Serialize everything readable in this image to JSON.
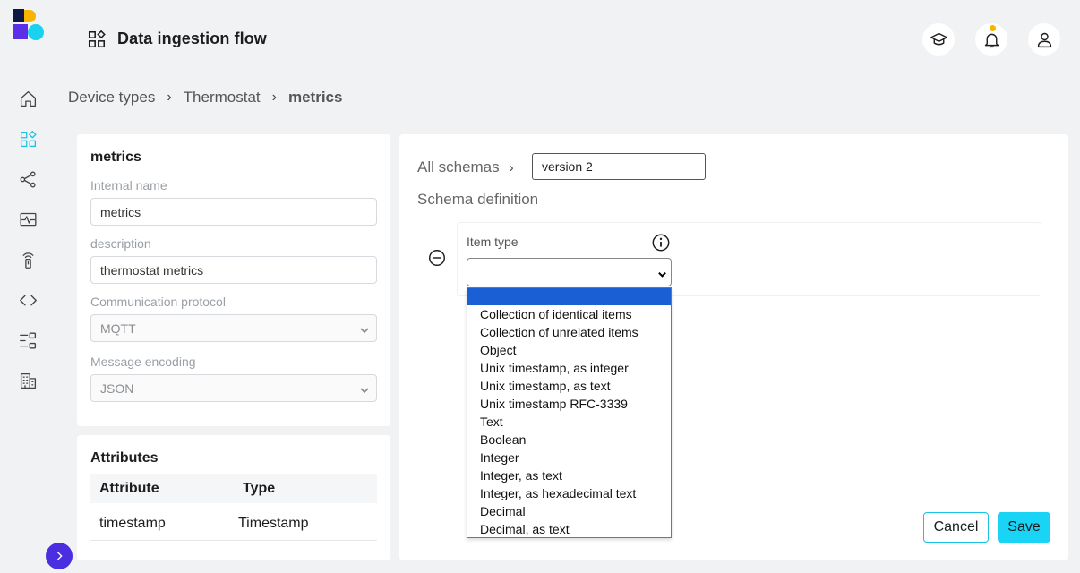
{
  "header": {
    "title": "Data ingestion flow"
  },
  "breadcrumb": [
    {
      "label": "Device types"
    },
    {
      "label": "Thermostat"
    },
    {
      "label": "metrics"
    }
  ],
  "breadcrumb_separator": "›",
  "details": {
    "title": "metrics",
    "internal_name_label": "Internal name",
    "internal_name_value": "metrics",
    "description_label": "description",
    "description_value": "thermostat metrics",
    "protocol_label": "Communication protocol",
    "protocol_value": "MQTT",
    "encoding_label": "Message encoding",
    "encoding_value": "JSON"
  },
  "attributes": {
    "title": "Attributes",
    "columns": [
      "Attribute",
      "Type"
    ],
    "rows": [
      {
        "attribute": "timestamp",
        "type": "Timestamp"
      }
    ]
  },
  "schema": {
    "crumb": "All schemas",
    "separator": "›",
    "version_value": "version 2",
    "definition_label": "Schema definition",
    "item_type_label": "Item type",
    "item_type_value": "",
    "options": [
      "",
      "Collection of identical items",
      "Collection of unrelated items",
      "Object",
      "Unix timestamp, as integer",
      "Unix timestamp, as text",
      "Unix timestamp RFC-3339",
      "Text",
      "Boolean",
      "Integer",
      "Integer, as text",
      "Integer, as hexadecimal text",
      "Decimal",
      "Decimal, as text"
    ]
  },
  "actions": {
    "cancel_label": "Cancel",
    "save_label": "Save"
  },
  "colors": {
    "accent": "#19c3e6",
    "brand_purple": "#4b2ee0",
    "selected_option": "#1a5fd4"
  }
}
